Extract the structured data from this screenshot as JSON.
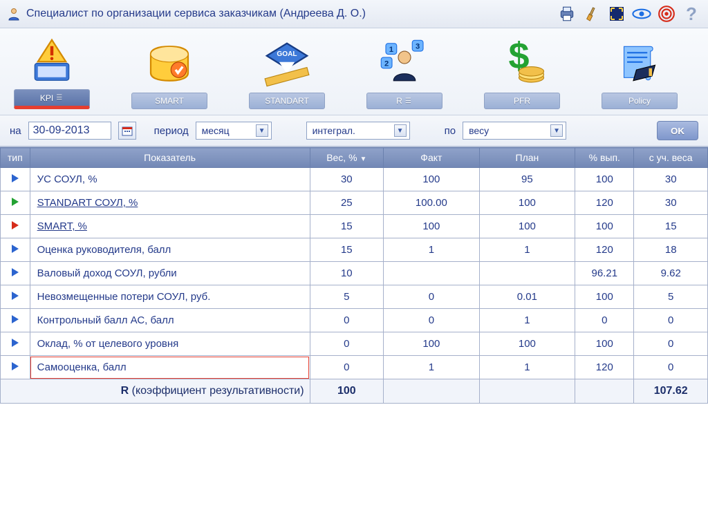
{
  "header": {
    "title": "Специалист по организации сервиса заказчикам  (Андреева Д. О.)"
  },
  "tabs": [
    {
      "id": "kpi",
      "label": "KPI",
      "active": true
    },
    {
      "id": "smart",
      "label": "SMART",
      "active": false
    },
    {
      "id": "standart",
      "label": "STANDART",
      "active": false
    },
    {
      "id": "r",
      "label": "R",
      "active": false
    },
    {
      "id": "pfr",
      "label": "PFR",
      "active": false
    },
    {
      "id": "policy",
      "label": "Policy",
      "active": false
    }
  ],
  "filters": {
    "date_label": "на",
    "date": "30-09-2013",
    "period_label": "период",
    "period_value": "месяц",
    "integral_value": "интеграл.",
    "by_label": "по",
    "by_value": "весу",
    "ok_label": "OK"
  },
  "columns": {
    "type": "тип",
    "indicator": "Показатель",
    "weight": "Вес, %",
    "fact": "Факт",
    "plan": "План",
    "pct": "% вып.",
    "weighted": "с уч. веса"
  },
  "rows": [
    {
      "tri": "blue",
      "name": "УС СОУЛ, %",
      "link": false,
      "w": "30",
      "fact": "100",
      "plan": "95",
      "pct": "100",
      "wt": "30"
    },
    {
      "tri": "green",
      "name": "STANDART СОУЛ, %",
      "link": true,
      "w": "25",
      "fact": "100.00",
      "plan": "100",
      "pct": "120",
      "wt": "30"
    },
    {
      "tri": "red",
      "name": "SMART, %",
      "link": true,
      "w": "15",
      "fact": "100",
      "plan": "100",
      "pct": "100",
      "wt": "15"
    },
    {
      "tri": "blue",
      "name": "Оценка руководителя, балл",
      "link": false,
      "w": "15",
      "fact": "1",
      "plan": "1",
      "pct": "120",
      "wt": "18"
    },
    {
      "tri": "blue",
      "name": "Валовый доход СОУЛ, рубли",
      "link": false,
      "w": "10",
      "fact": "",
      "plan": "",
      "pct": "96.21",
      "wt": "9.62"
    },
    {
      "tri": "blue",
      "name": "Невозмещенные потери СОУЛ, руб.",
      "link": false,
      "w": "5",
      "fact": "0",
      "plan": "0.01",
      "pct": "100",
      "wt": "5"
    },
    {
      "tri": "blue",
      "name": "Контрольный балл АС, балл",
      "link": false,
      "w": "0",
      "fact": "0",
      "plan": "1",
      "pct": "0",
      "wt": "0"
    },
    {
      "tri": "blue",
      "name": "Оклад, % от целевого уровня",
      "link": false,
      "w": "0",
      "fact": "100",
      "plan": "100",
      "pct": "100",
      "wt": "0"
    },
    {
      "tri": "blue",
      "name": "Самооценка, балл",
      "link": false,
      "w": "0",
      "fact": "1",
      "plan": "1",
      "pct": "120",
      "wt": "0",
      "highlight": true
    }
  ],
  "total": {
    "label_r": "R",
    "label_desc": " (коэффициент результативности)",
    "weight": "100",
    "fact": "",
    "plan": "",
    "pct": "",
    "weighted": "107.62"
  }
}
